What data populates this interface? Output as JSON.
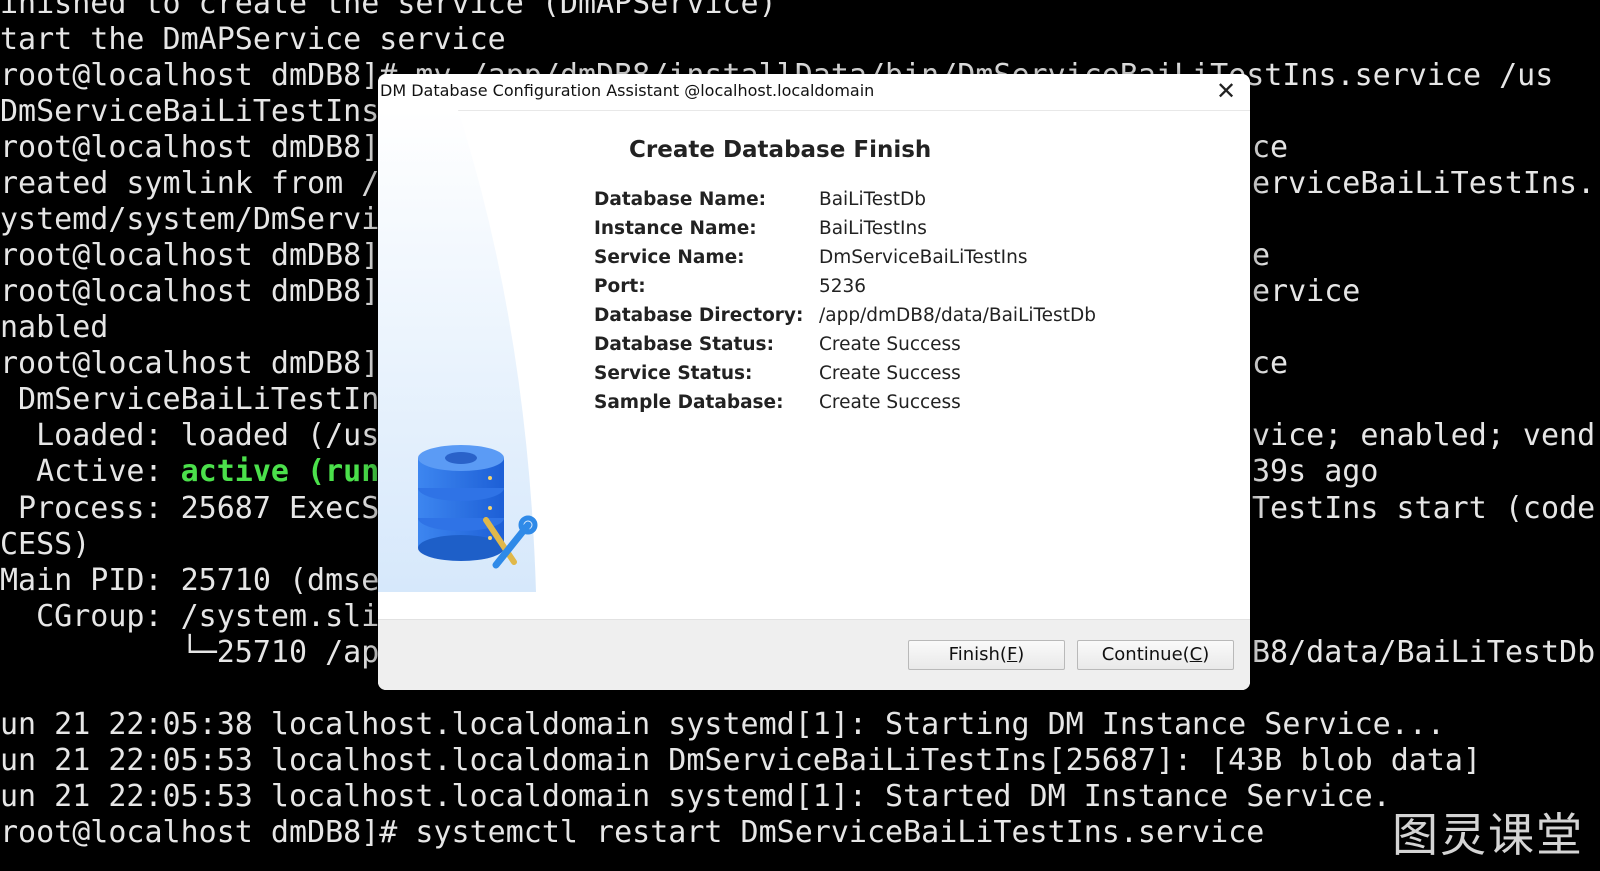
{
  "terminal": {
    "lines": [
      "inished to create the service (DmAPService)",
      "tart the DmAPService service",
      "root@localhost dmDB8]# mv /app/dmDB8/installData/bin/DmServiceBaiLiTestIns.service /us",
      "DmServiceBaiLiTestIns",
      "root@localhost dmDB8]",
      "reated symlink from /",
      "ystemd/system/DmServi",
      "root@localhost dmDB8]",
      "root@localhost dmDB8]",
      "nabled",
      "root@localhost dmDB8]",
      " DmServiceBaiLiTestIn",
      "  Loaded: loaded (/us",
      "  Active: ",
      " Process: 25687 ExecS",
      "CESS)",
      "Main PID: 25710 (dmse",
      "  CGroup: /system.sli",
      "          └─25710 /ap",
      "",
      "un 21 22:05:38 localhost.localdomain systemd[1]: Starting DM Instance Service...",
      "un 21 22:05:53 localhost.localdomain DmServiceBaiLiTestIns[25687]: [43B blob data]",
      "un 21 22:05:53 localhost.localdomain systemd[1]: Started DM Instance Service.",
      "root@localhost dmDB8]# systemctl restart DmServiceBaiLiTestIns.service"
    ],
    "active_status": "active (run",
    "right_fragments": [
      {
        "row": 4,
        "text": "ce"
      },
      {
        "row": 5,
        "text": "erviceBaiLiTestIns."
      },
      {
        "row": 7,
        "text": "e"
      },
      {
        "row": 8,
        "text": "ervice"
      },
      {
        "row": 10,
        "text": "ce"
      },
      {
        "row": 12,
        "text": "vice; enabled; vend"
      },
      {
        "row": 13,
        "text": "39s ago"
      },
      {
        "row": 14,
        "text": "TestIns start (code"
      },
      {
        "row": 18,
        "text": "B8/data/BaiLiTestDb"
      }
    ]
  },
  "dialog": {
    "title": "DM Database Configuration Assistant @localhost.localdomain",
    "close_glyph": "✕",
    "heading": "Create Database Finish",
    "fields": [
      {
        "label": "Database Name:",
        "value": "BaiLiTestDb"
      },
      {
        "label": "Instance Name:",
        "value": "BaiLiTestIns"
      },
      {
        "label": "Service Name:",
        "value": "DmServiceBaiLiTestIns"
      },
      {
        "label": "Port:",
        "value": "5236"
      },
      {
        "label": "Database Directory:",
        "value": "/app/dmDB8/data/BaiLiTestDb"
      },
      {
        "label": "Database Status:",
        "value": "Create Success"
      },
      {
        "label": "Service Status:",
        "value": "Create Success"
      },
      {
        "label": "Sample Database:",
        "value": "Create Success"
      }
    ],
    "buttons": {
      "finish": {
        "text": "Finish(",
        "mnemonic": "F",
        "suffix": ")"
      },
      "continue": {
        "text": "Continue(",
        "mnemonic": "C",
        "suffix": ")"
      }
    },
    "icon": "database-tools-icon"
  },
  "watermark": "图灵课堂",
  "colors": {
    "terminal_bg": "#000000",
    "terminal_fg": "#e6e6e6",
    "active_green": "#4be04b",
    "db_blue": "#2f73e6"
  }
}
